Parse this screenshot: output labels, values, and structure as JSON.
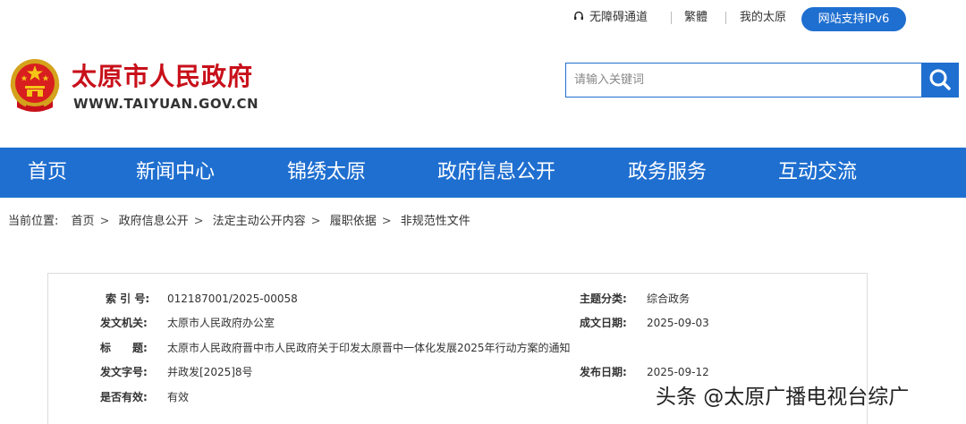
{
  "utility": {
    "accessibility": "无障碍通道",
    "traditional": "繁體",
    "my_taiyuan": "我的太原",
    "ipv6": "网站支持IPv6"
  },
  "header": {
    "site_name": "太原市人民政府",
    "site_url": "WWW.TAIYUAN.GOV.CN"
  },
  "search": {
    "placeholder": "请输入关键词"
  },
  "nav": {
    "items": [
      "首页",
      "新闻中心",
      "锦绣太原",
      "政府信息公开",
      "政务服务",
      "互动交流"
    ]
  },
  "breadcrumb": {
    "prefix": "当前位置:",
    "items": [
      "首页",
      "政府信息公开",
      "法定主动公开内容",
      "履职依据",
      "非规范性文件"
    ]
  },
  "info": {
    "index_label": "索 引 号:",
    "index_value": "012187001/2025-00058",
    "category_label": "主题分类:",
    "category_value": "综合政务",
    "issuer_label": "发文机关:",
    "issuer_value": "太原市人民政府办公室",
    "created_label": "成文日期:",
    "created_value": "2025-09-03",
    "title_label": "标　　题:",
    "title_value": "太原市人民政府晋中市人民政府关于印发太原晋中一体化发展2025年行动方案的通知",
    "docno_label": "发文字号:",
    "docno_value": "并政发[2025]8号",
    "published_label": "发布日期:",
    "published_value": "2025-09-12",
    "valid_label": "是否有效:",
    "valid_value": "有效"
  },
  "watermark": "头条 @太原广播电视台综广",
  "colors": {
    "brand_blue": "#1f6fd0",
    "brand_red": "#c8101a"
  },
  "icons": {
    "accessibility": "headset-icon",
    "search": "search-icon",
    "emblem": "national-emblem-icon"
  }
}
